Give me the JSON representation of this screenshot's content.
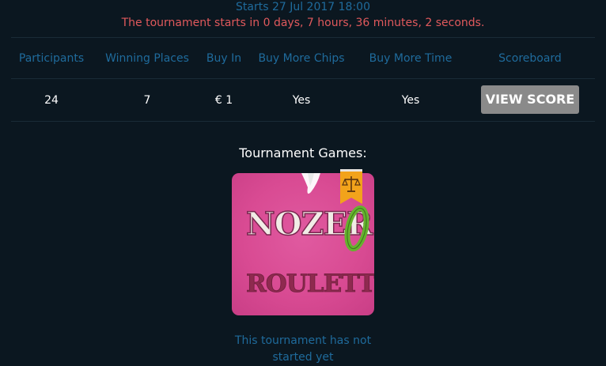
{
  "tournament": {
    "starts": "Starts 27 Jul 2017 18:00",
    "countdown": "The tournament starts in 0 days, 7 hours, 36 minutes, 2 seconds."
  },
  "table": {
    "headers": {
      "participants": "Participants",
      "winning_places": "Winning Places",
      "buy_in": "Buy In",
      "buy_more_chips": "Buy More Chips",
      "buy_more_time": "Buy More Time",
      "scoreboard": "Scoreboard"
    },
    "row": {
      "participants": "24",
      "winning_places": "7",
      "buy_in": "€ 1",
      "buy_more_chips": "Yes",
      "buy_more_time": "Yes",
      "view_score_label": "VIEW SCORE"
    }
  },
  "games": {
    "title": "Tournament Games:",
    "items": [
      {
        "logo_line1": "NOZERO",
        "logo_line2": "ROULETTE",
        "badge_icon": "scales-icon"
      }
    ]
  },
  "status": {
    "line1": "This tournament has not",
    "line2": "started yet"
  },
  "colors": {
    "background": "#0b1720",
    "header_text": "#1f6b9c",
    "countdown_text": "#e0595c",
    "button_bg": "#8a8a8a",
    "tile_pink": "#d94b93"
  }
}
